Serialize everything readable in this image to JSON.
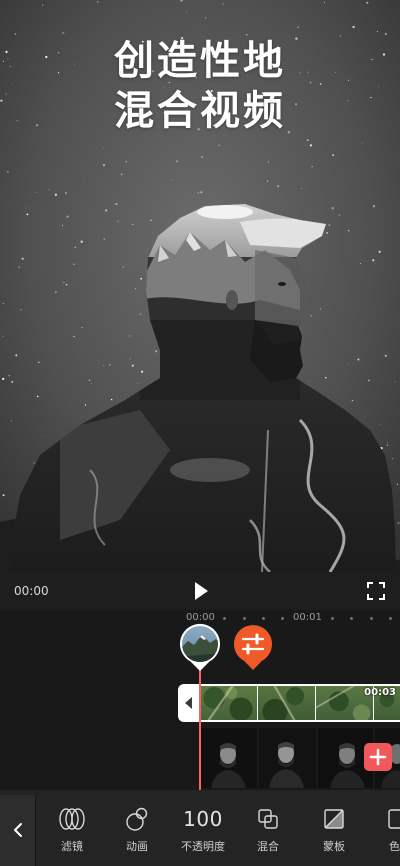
{
  "theme": {
    "accent": "#f05a28",
    "playhead": "#ff6161",
    "add_button": "#f0585c"
  },
  "hero": {
    "title_line1": "创造性地",
    "title_line2": "混合视频"
  },
  "player": {
    "current_time": "00:00",
    "play_icon": "play-icon",
    "fullscreen_icon": "fullscreen-icon"
  },
  "timeline": {
    "ruler_labels": [
      "00:00",
      "00:01"
    ],
    "keyframe_marker": {
      "icon": "mountain-thumbnail"
    },
    "adjust_marker": {
      "icon": "sliders-icon"
    },
    "main_clip": {
      "duration": "00:03",
      "handle_icon": "trim-handle-left-icon"
    },
    "overlay_clip": {
      "add_icon": "plus-icon"
    }
  },
  "toolbar": {
    "back_icon": "chevron-left-icon",
    "items": [
      {
        "label": "滤镜",
        "icon": "filter-icon"
      },
      {
        "label": "动画",
        "icon": "animation-icon"
      },
      {
        "label": "不透明度",
        "value": "100"
      },
      {
        "label": "混合",
        "icon": "blend-icon"
      },
      {
        "label": "蒙板",
        "icon": "mask-icon"
      },
      {
        "label": "色",
        "icon": "color-icon"
      }
    ]
  }
}
